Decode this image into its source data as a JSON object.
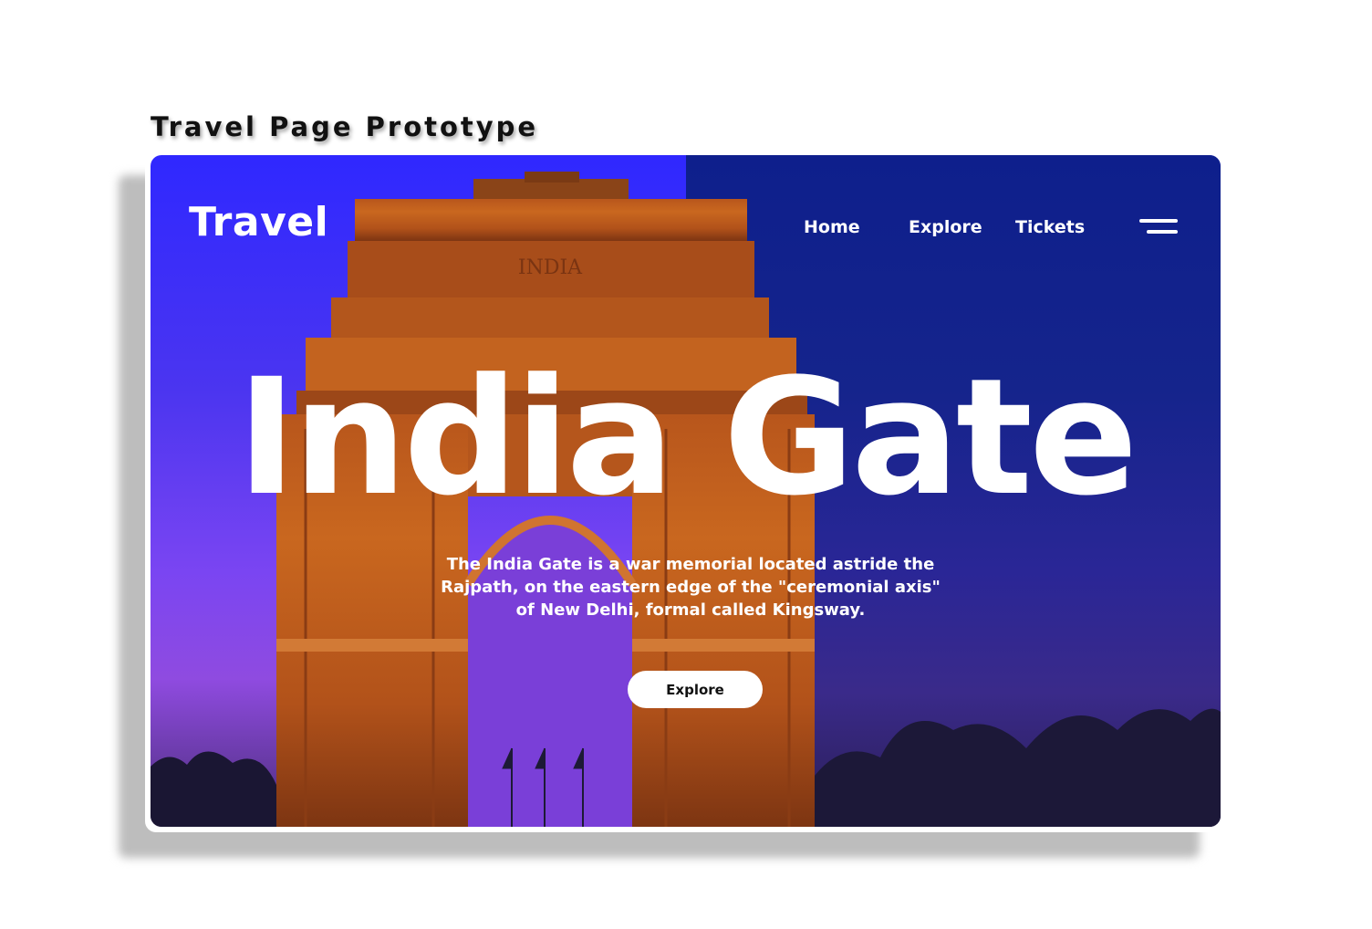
{
  "caption": "Travel Page Prototype",
  "nav": {
    "logo": "Travel",
    "links": [
      "Home",
      "Explore",
      "Tickets"
    ]
  },
  "hero": {
    "title": "India Gate",
    "description": "The India Gate is a war memorial located astride the Rajpath, on the eastern edge of the \"ceremonial axis\" of New Delhi, formal called Kingsway.",
    "cta_label": "Explore",
    "monument_inscription": "INDIA"
  },
  "icons": {
    "menu": "hamburger-menu-icon"
  },
  "colors": {
    "sky_left": "#2f28ff",
    "overlay_right": "#15248c",
    "text": "#ffffff",
    "button_bg": "#ffffff"
  }
}
